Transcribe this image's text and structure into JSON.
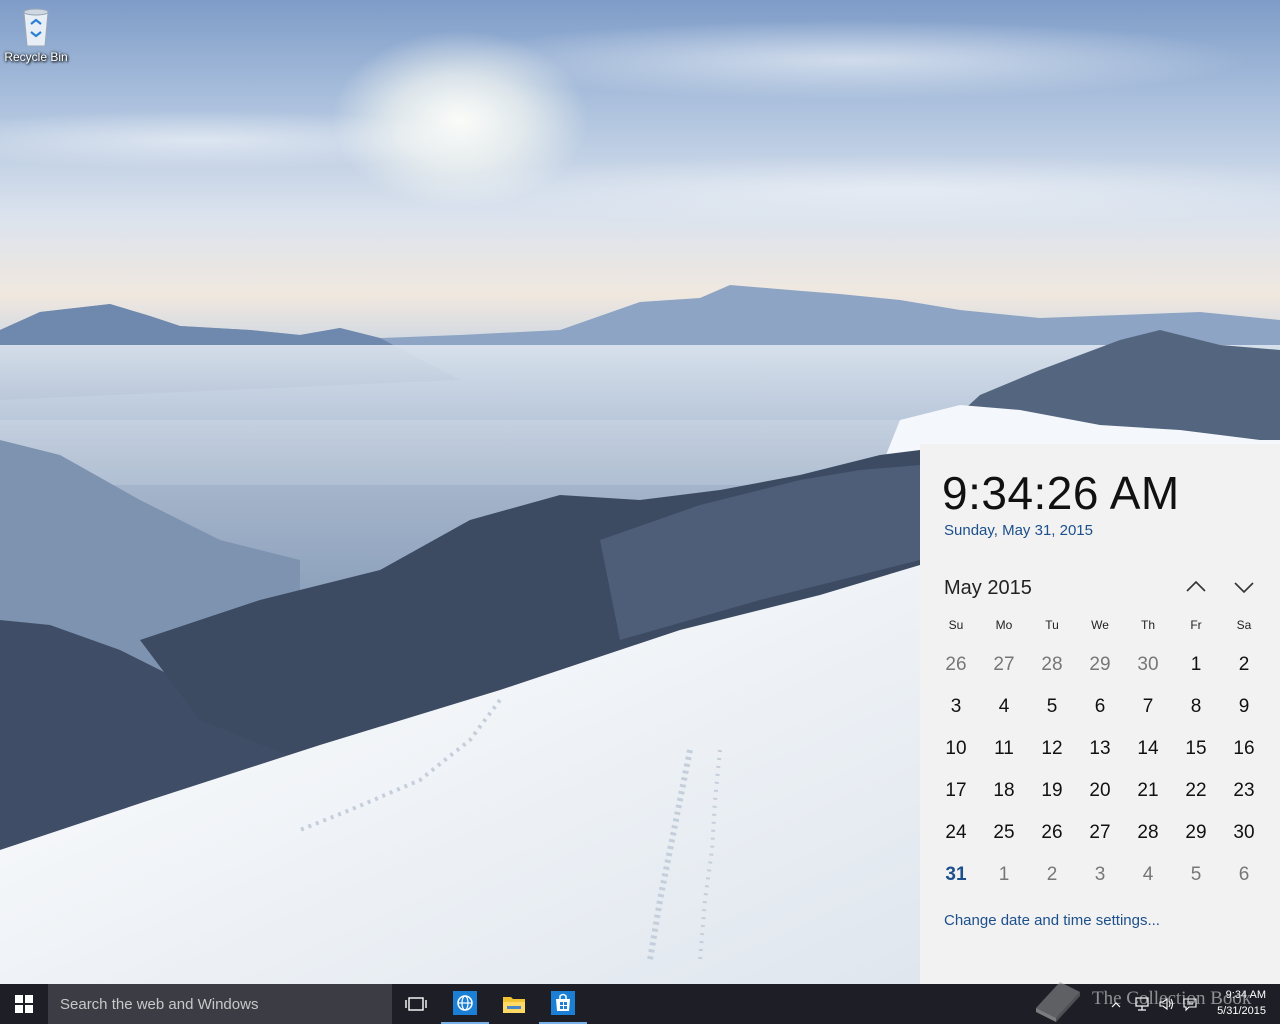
{
  "desktop": {
    "recycle_bin_label": "Recycle Bin"
  },
  "clock_flyout": {
    "time": "9:34:26 AM",
    "date": "Sunday, May 31, 2015",
    "month_label": "May 2015",
    "days_of_week": [
      "Su",
      "Mo",
      "Tu",
      "We",
      "Th",
      "Fr",
      "Sa"
    ],
    "weeks": [
      [
        "26",
        "27",
        "28",
        "29",
        "30",
        "1",
        "2"
      ],
      [
        "3",
        "4",
        "5",
        "6",
        "7",
        "8",
        "9"
      ],
      [
        "10",
        "11",
        "12",
        "13",
        "14",
        "15",
        "16"
      ],
      [
        "17",
        "18",
        "19",
        "20",
        "21",
        "22",
        "23"
      ],
      [
        "24",
        "25",
        "26",
        "27",
        "28",
        "29",
        "30"
      ],
      [
        "31",
        "1",
        "2",
        "3",
        "4",
        "5",
        "6"
      ]
    ],
    "settings_link": "Change date and time settings...",
    "accent_color": "#1c4f8c"
  },
  "taskbar": {
    "search_placeholder": "Search the web and Windows",
    "pinned": [
      {
        "name": "task-view-icon"
      },
      {
        "name": "internet-explorer-icon"
      },
      {
        "name": "file-explorer-icon"
      },
      {
        "name": "store-icon"
      }
    ],
    "clock_time": "9:34 AM",
    "clock_date": "5/31/2015",
    "background_color": "#1e1f26"
  },
  "watermark": {
    "text": "The Collection Book"
  }
}
